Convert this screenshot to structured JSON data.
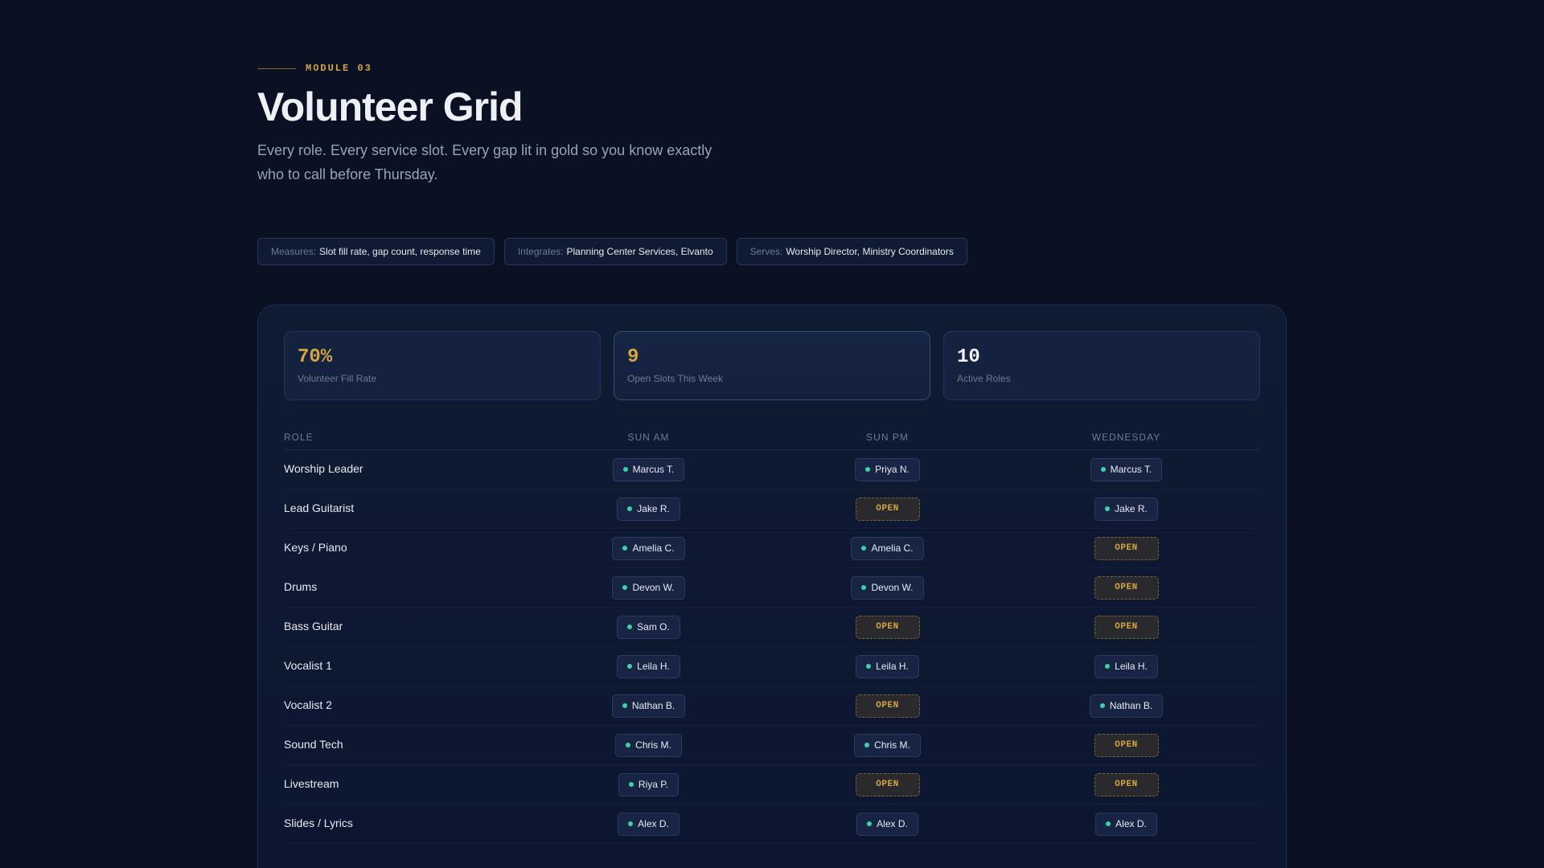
{
  "header": {
    "eyebrow": "MODULE 03",
    "title": "Volunteer Grid",
    "subtitle": "Every role. Every service slot. Every gap lit in gold so you know exactly who to call before Thursday."
  },
  "pills": [
    {
      "key": "Measures:",
      "value": "Slot fill rate, gap count, response time"
    },
    {
      "key": "Integrates:",
      "value": "Planning Center Services, Elvanto"
    },
    {
      "key": "Serves:",
      "value": "Worship Director, Ministry Coordinators"
    }
  ],
  "stats": [
    {
      "value": "70%",
      "label": "Volunteer Fill Rate",
      "accent": "#d4a640"
    },
    {
      "value": "9",
      "label": "Open Slots This Week",
      "accent": "#d4a640"
    },
    {
      "value": "10",
      "label": "Active Roles",
      "accent": "#f0f2f7"
    }
  ],
  "table": {
    "headers": [
      "ROLE",
      "SUN AM",
      "SUN PM",
      "WEDNESDAY"
    ],
    "open_label": "OPEN",
    "rows": [
      {
        "role": "Worship Leader",
        "slots": [
          "Marcus T.",
          "Priya N.",
          "Marcus T."
        ]
      },
      {
        "role": "Lead Guitarist",
        "slots": [
          "Jake R.",
          "OPEN",
          "Jake R."
        ]
      },
      {
        "role": "Keys / Piano",
        "slots": [
          "Amelia C.",
          "Amelia C.",
          "OPEN"
        ]
      },
      {
        "role": "Drums",
        "slots": [
          "Devon W.",
          "Devon W.",
          "OPEN"
        ]
      },
      {
        "role": "Bass Guitar",
        "slots": [
          "Sam O.",
          "OPEN",
          "OPEN"
        ]
      },
      {
        "role": "Vocalist 1",
        "slots": [
          "Leila H.",
          "Leila H.",
          "Leila H."
        ]
      },
      {
        "role": "Vocalist 2",
        "slots": [
          "Nathan B.",
          "OPEN",
          "Nathan B."
        ]
      },
      {
        "role": "Sound Tech",
        "slots": [
          "Chris M.",
          "Chris M.",
          "OPEN"
        ]
      },
      {
        "role": "Livestream",
        "slots": [
          "Riya P.",
          "OPEN",
          "OPEN"
        ]
      },
      {
        "role": "Slides / Lyrics",
        "slots": [
          "Alex D.",
          "Alex D.",
          "Alex D."
        ]
      }
    ]
  },
  "colors": {
    "background": "#0a1122",
    "gold": "#d4a640",
    "filled_dot": "#3fd1a6"
  }
}
